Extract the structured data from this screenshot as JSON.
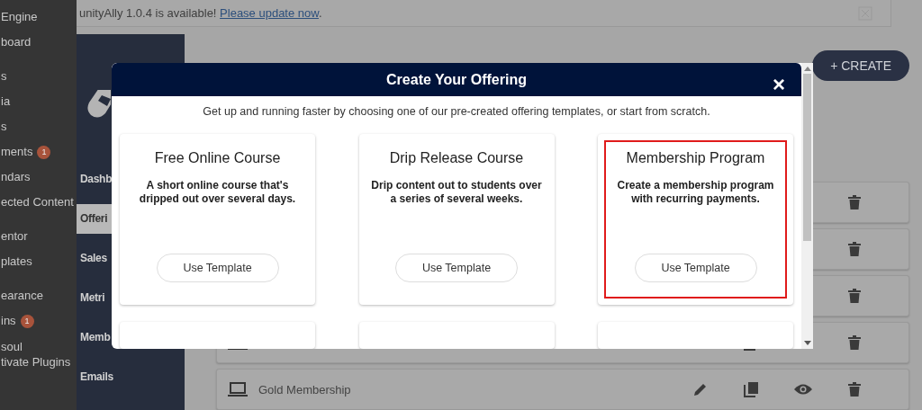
{
  "wp_sidebar": {
    "items": [
      {
        "label": "Engine"
      },
      {
        "label": "board"
      },
      {
        "label": "s"
      },
      {
        "label": "ia"
      },
      {
        "label": "s"
      },
      {
        "label": "ments",
        "badge": "1"
      },
      {
        "label": "ndars"
      },
      {
        "label": "ected Content"
      },
      {
        "label": "entor"
      },
      {
        "label": "plates"
      },
      {
        "label": "earance"
      },
      {
        "label": "ins",
        "badge": "1"
      },
      {
        "label": "soul\ntivate Plugins"
      }
    ]
  },
  "notice": {
    "text": "unityAlly 1.0.4 is available! ",
    "link": "Please update now",
    "end": "."
  },
  "app_sidebar": {
    "items": [
      {
        "label": "Dashb",
        "selected": false
      },
      {
        "label": "Offeri",
        "selected": true
      },
      {
        "label": "Sales",
        "selected": false
      },
      {
        "label": "Metri",
        "selected": false
      },
      {
        "label": "Memb",
        "selected": false
      },
      {
        "label": "Emails",
        "selected": false
      }
    ]
  },
  "create_button": "+ CREATE",
  "rows": [
    {
      "kind": "covered"
    },
    {
      "kind": "covered"
    },
    {
      "kind": "covered"
    },
    {
      "kind": "partial"
    },
    {
      "kind": "full",
      "name": "Gold Membership"
    }
  ],
  "modal": {
    "title": "Create Your Offering",
    "close": "×",
    "subtitle": "Get up and running faster by choosing one of our pre-created offering templates, or start from scratch.",
    "cards": [
      {
        "title": "Free Online Course",
        "description": "A short online course that's dripped out over several days.",
        "button": "Use Template",
        "highlighted": false
      },
      {
        "title": "Drip Release Course",
        "description": "Drip content out to students over a series of several weeks.",
        "button": "Use Template",
        "highlighted": false
      },
      {
        "title": "Membership Program",
        "description": "Create a membership program with recurring payments.",
        "button": "Use Template",
        "highlighted": true
      }
    ]
  }
}
